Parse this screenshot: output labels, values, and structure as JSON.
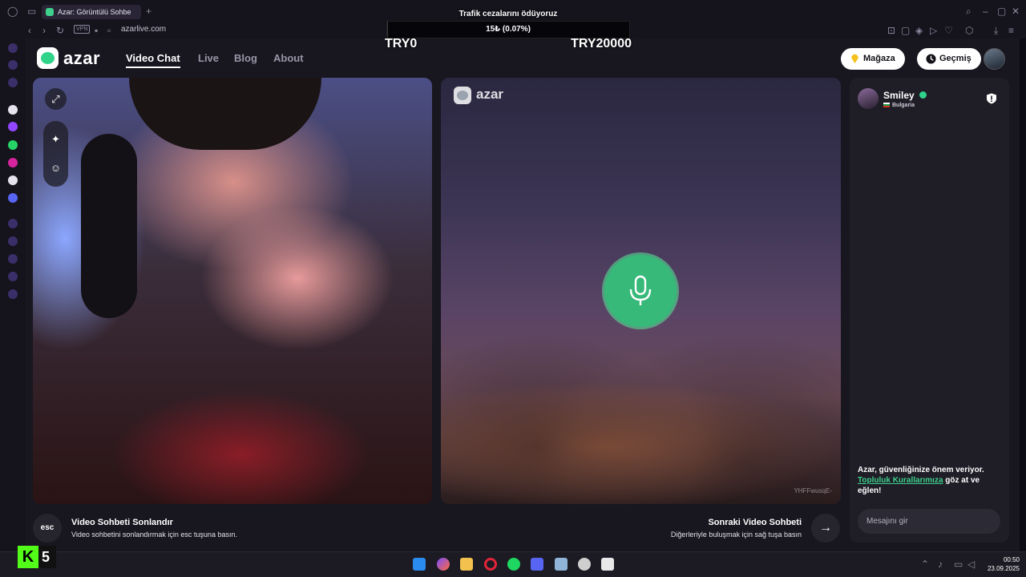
{
  "browser": {
    "tab_title": "Azar: Görüntülü Sohbe",
    "url": "azarlive.com",
    "vpn_label": "VPN",
    "new_tab_glyph": "+"
  },
  "overlay": {
    "title": "Trafik cezalarını ödüyoruz",
    "progress_text": "15₺ (0.07%)",
    "progress_fraction": 0.0007,
    "min_label": "TRY0",
    "max_label": "TRY20000"
  },
  "site": {
    "logo_text": "azar",
    "nav": [
      {
        "label": "Video Chat",
        "active": true
      },
      {
        "label": "Live",
        "active": false
      },
      {
        "label": "Blog",
        "active": false
      },
      {
        "label": "About",
        "active": false
      }
    ],
    "store_label": "Mağaza",
    "history_label": "Geçmiş"
  },
  "remote": {
    "watermark": "azar",
    "session_id": "YHFFwusqE-"
  },
  "actions": {
    "end_key": "esc",
    "end_title": "Video Sohbeti Sonlandır",
    "end_sub": "Video sohbetini sonlandırmak için esc tuşuna basın.",
    "next_title": "Sonraki Video Sohbeti",
    "next_sub": "Diğerleriyle buluşmak için sağ tuşa basın"
  },
  "chat": {
    "partner_name": "Smiley",
    "partner_country": "Bulgaria",
    "safety_text_1": "Azar, güvenliğinize önem veriyor.",
    "safety_link": "Topluluk Kurallarımıza",
    "safety_text_2": "göz at ve eğlen!",
    "input_placeholder": "Mesajını gir"
  },
  "taskbar": {
    "time": "00:50",
    "date": "23.09.2025"
  },
  "stream_badge": {
    "letter": "K",
    "number": "5"
  },
  "colors": {
    "accent_green": "#2fd38a",
    "mic_green": "#36b979",
    "kick_green": "#53fc18"
  }
}
